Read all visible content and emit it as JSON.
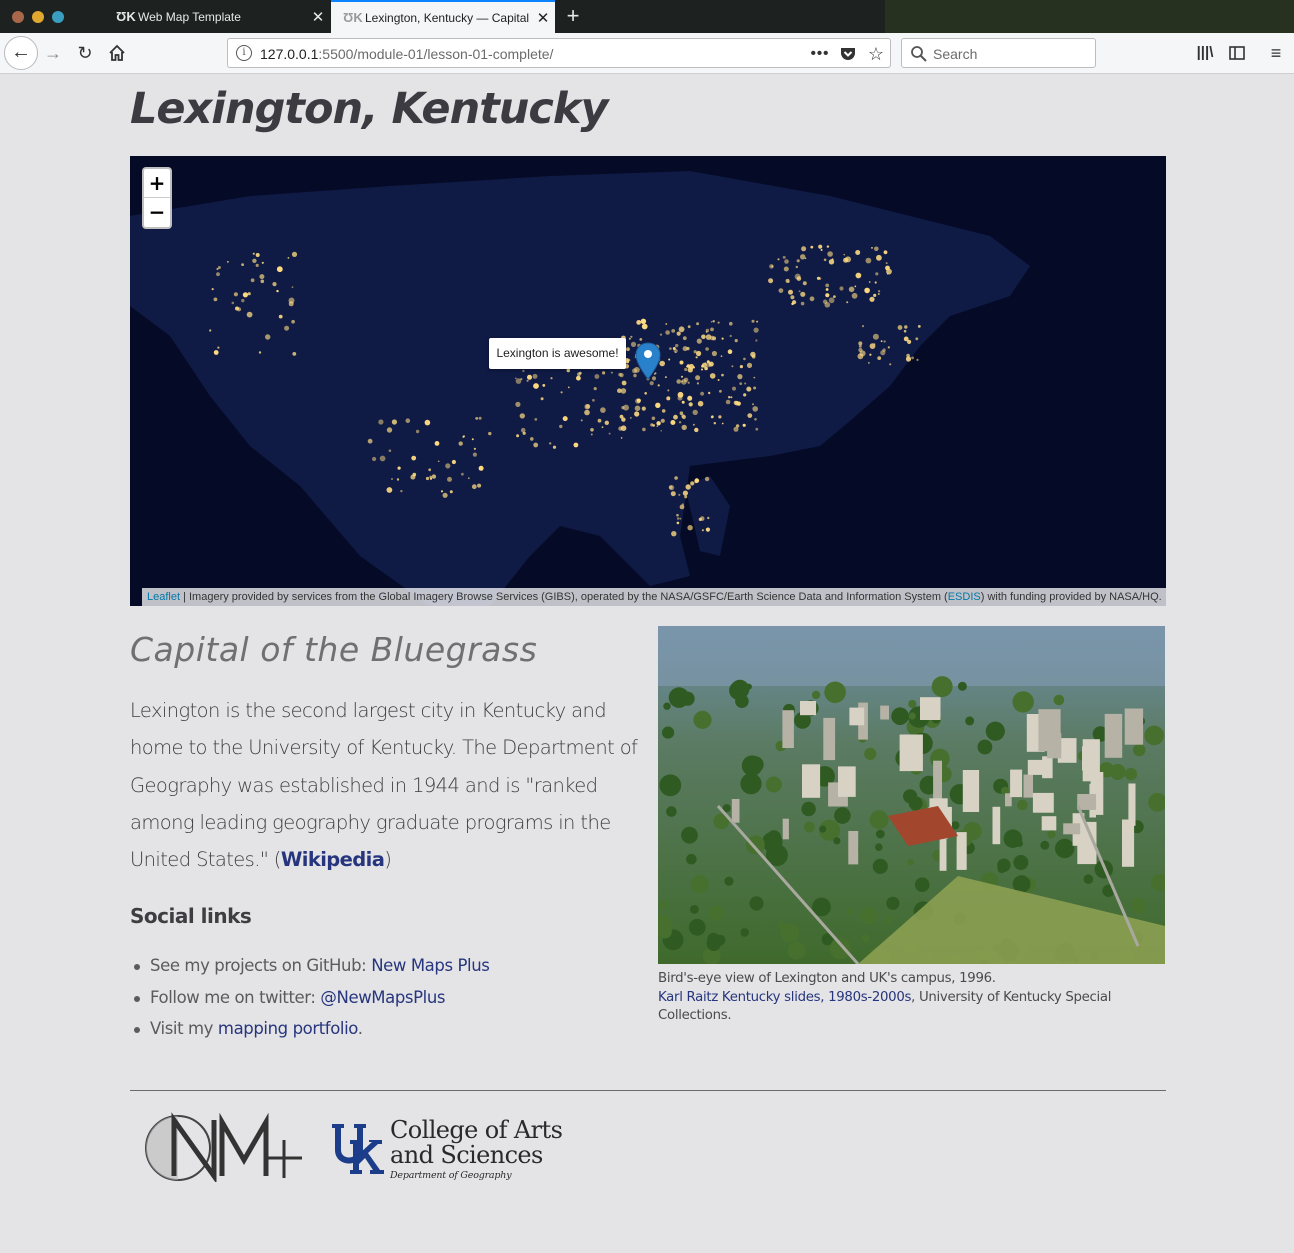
{
  "browser": {
    "tabs": [
      {
        "title": "Web Map Template",
        "active": false
      },
      {
        "title": "Lexington, Kentucky — Capital of the Bluegrass",
        "active": true
      }
    ],
    "url_host": "127.0.0.1",
    "url_path": ":5500/module-01/lesson-01-complete/",
    "search_placeholder": "Search",
    "icons": {
      "back": "back-arrow-icon",
      "forward": "forward-arrow-icon",
      "reload": "reload-icon",
      "home": "home-icon",
      "info": "info-icon",
      "more": "more-icon",
      "pocket": "pocket-icon",
      "bookmark": "star-icon",
      "library": "library-icon",
      "sidebar": "sidebar-icon",
      "menu": "hamburger-menu-icon"
    }
  },
  "page": {
    "title": "Lexington, Kentucky",
    "map": {
      "zoom_in": "+",
      "zoom_out": "−",
      "popup": "Lexington is awesome!",
      "attribution_link": "Leaflet",
      "attribution_text_1": " | Imagery provided by services from the Global Imagery Browse Services (GIBS), operated by the NASA/GSFC/Earth Science Data and Information System (",
      "attribution_esdis": "ESDIS",
      "attribution_text_2": ") with funding provided by NASA/HQ."
    },
    "subtitle": "Capital of the Bluegrass",
    "intro_text": "Lexington is the second largest city in Kentucky and home to the University of Kentucky. The Department of Geography was established in 1944 and is \"ranked among leading geography graduate programs in the United States.\" (",
    "intro_link": "Wikipedia",
    "intro_end": ")",
    "social_heading": "Social links",
    "social": [
      {
        "prefix": "See my projects on GitHub: ",
        "link": "New Maps Plus",
        "suffix": ""
      },
      {
        "prefix": "Follow me on twitter: ",
        "link": "@NewMapsPlus",
        "suffix": ""
      },
      {
        "prefix": "Visit my ",
        "link": "mapping portfolio",
        "suffix": "."
      }
    ],
    "photo_caption_line1": "Bird's-eye view of Lexington and UK's campus, 1996.",
    "photo_caption_link": "Karl Raitz Kentucky slides, 1980s-2000s",
    "photo_caption_rest": ", University of Kentucky Special Collections.",
    "footer": {
      "uk_name_line1": "College of Arts",
      "uk_name_line2": "and Sciences",
      "uk_dept": "Department of Geography"
    }
  },
  "colors": {
    "page_bg": "#e4e4e6",
    "link": "#26357d",
    "map_bg": "#050a26",
    "marker": "#2a81cb",
    "city_lights": "#ffdc82"
  }
}
